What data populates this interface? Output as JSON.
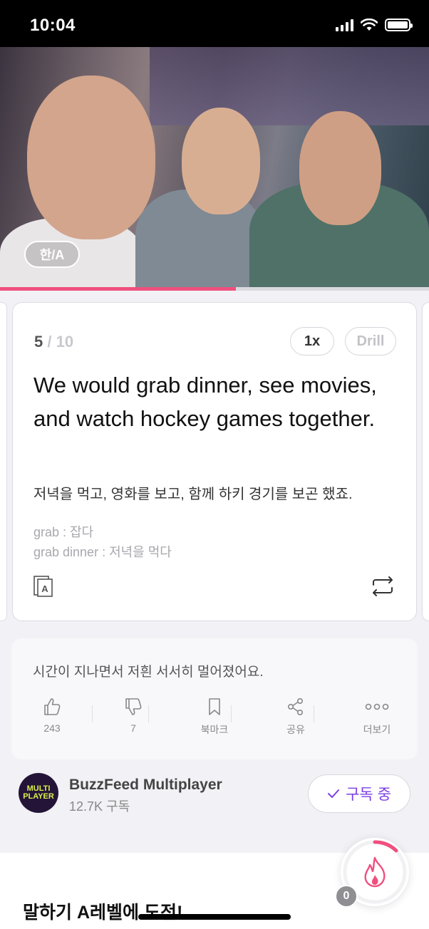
{
  "status_bar": {
    "time": "10:04"
  },
  "player": {
    "language_toggle": "한/A",
    "progress_fraction": 0.55
  },
  "card": {
    "current": "5",
    "total": "/ 10",
    "speed": "1x",
    "drill": "Drill",
    "sentence": "We would grab dinner, see movies, and watch hockey games together.",
    "translation": "저녁을 먹고, 영화를 보고, 함께 하키 경기를 보곤 했죠.",
    "vocab": [
      "grab : 잡다",
      "grab dinner : 저녁을 먹다"
    ]
  },
  "info": {
    "description": "시간이 지나면서 저흰 서서히 멀어졌어요.",
    "actions": [
      {
        "icon": "thumbs-up-icon",
        "label": "243"
      },
      {
        "icon": "thumbs-down-icon",
        "label": "7"
      },
      {
        "icon": "bookmark-icon",
        "label": "북마크"
      },
      {
        "icon": "share-icon",
        "label": "공유"
      },
      {
        "icon": "more-icon",
        "label": "더보기"
      }
    ]
  },
  "channel": {
    "avatar_text": [
      "MULTI",
      "PLAYER"
    ],
    "name": "BuzzFeed Multiplayer",
    "subscribers": "12.7K 구독",
    "subscribe_label": "구독 중"
  },
  "bottom": {
    "challenge": "말하기 A레벨에 도전!",
    "badge_count": "0"
  },
  "colors": {
    "accent": "#f04f7e",
    "brand_purple": "#7b3fe4"
  }
}
